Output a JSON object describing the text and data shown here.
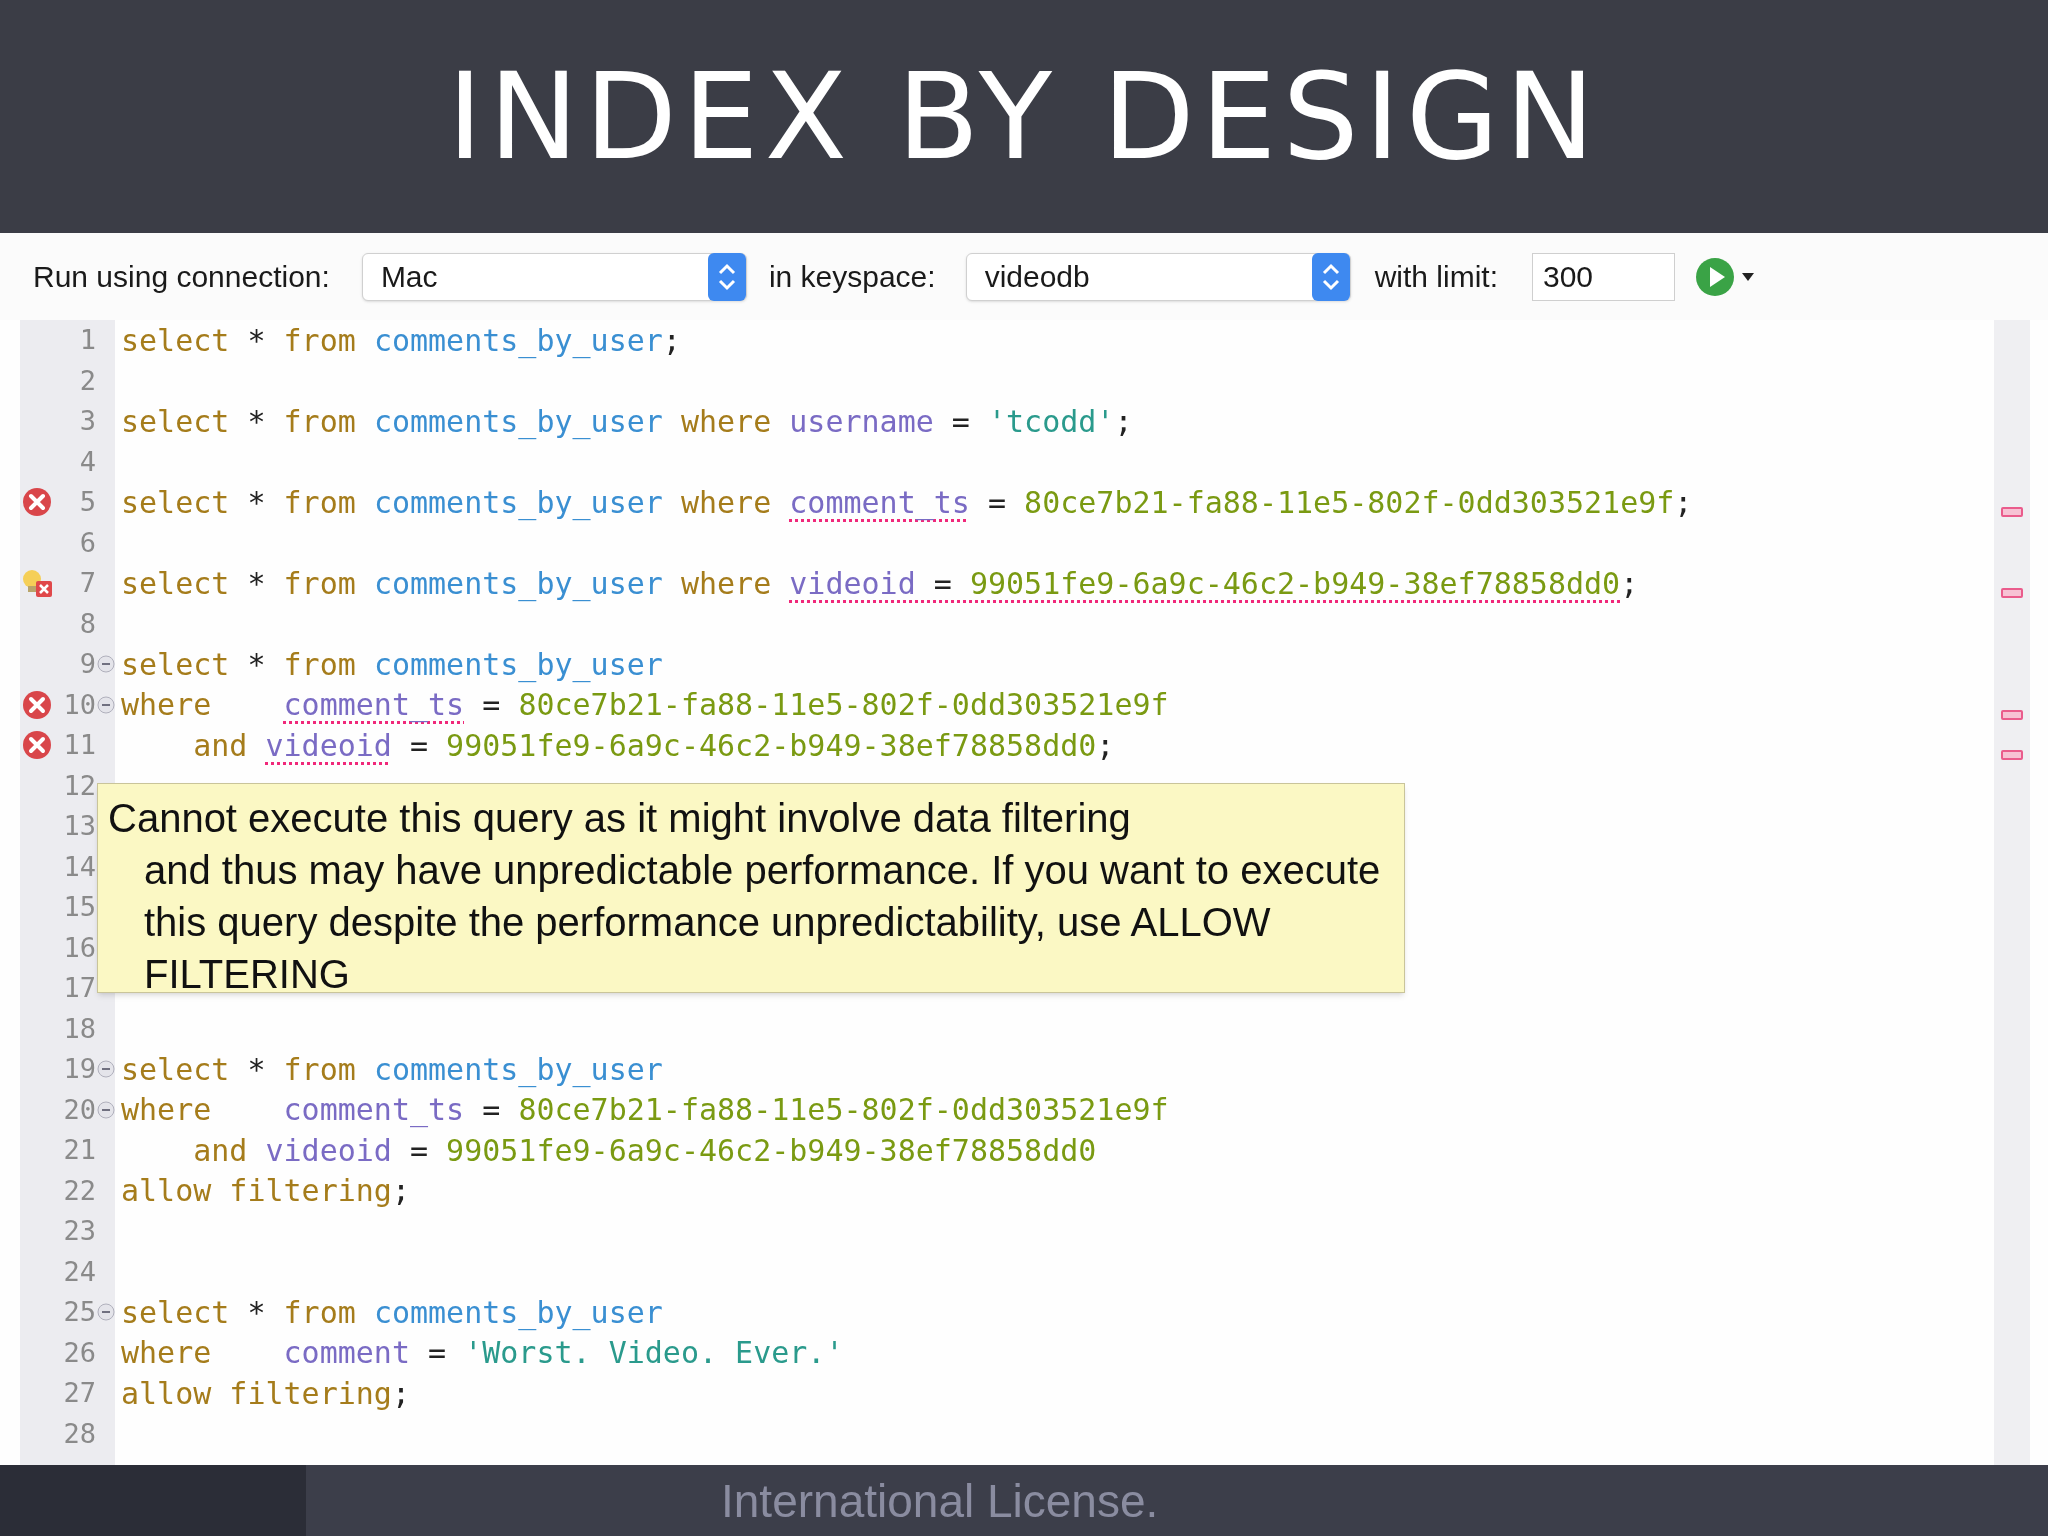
{
  "slide_title": "INDEX BY DESIGN",
  "toolbar": {
    "connection_label": "Run using connection:",
    "connection": "Mac",
    "keyspace_label": "in keyspace:",
    "keyspace": "videodb",
    "limit_label": "with limit:",
    "limit": "300"
  },
  "lines": [
    {
      "number": "1",
      "error": false,
      "warning": false,
      "tokens": [
        {
          "kind": "keyword",
          "text": "select"
        },
        {
          "kind": "plain",
          "text": "*"
        },
        {
          "kind": "keyword",
          "text": "from"
        },
        {
          "kind": "table",
          "text": "comments_by_user"
        },
        {
          "kind": "punct",
          "text": ";"
        }
      ]
    },
    {
      "number": "2",
      "error": false,
      "warning": false
    },
    {
      "number": "3",
      "error": false,
      "warning": false,
      "tokens": [
        {
          "kind": "keyword",
          "text": "select"
        },
        {
          "kind": "plain",
          "text": "*"
        },
        {
          "kind": "keyword",
          "text": "from"
        },
        {
          "kind": "table",
          "text": "comments_by_user"
        },
        {
          "kind": "keyword",
          "text": "where"
        },
        {
          "kind": "column",
          "text": "username"
        },
        {
          "kind": "plain",
          "text": "="
        },
        {
          "kind": "string",
          "text": "'tcodd'"
        },
        {
          "kind": "punct",
          "text": ";"
        }
      ]
    },
    {
      "number": "4",
      "error": false,
      "warning": false
    },
    {
      "number": "5",
      "error": true,
      "warning": false,
      "tokens": [
        {
          "kind": "keyword",
          "text": "select"
        },
        {
          "kind": "plain",
          "text": "*"
        },
        {
          "kind": "keyword",
          "text": "from"
        },
        {
          "kind": "table",
          "text": "comments_by_user"
        },
        {
          "kind": "keyword",
          "text": "where"
        },
        {
          "kind": "column",
          "text": "comment_ts",
          "squiggle": true
        },
        {
          "kind": "plain",
          "text": "="
        },
        {
          "kind": "uuid",
          "text": "80ce7b21-fa88-11e5-802f-0dd303521e9f"
        },
        {
          "kind": "punct",
          "text": ";"
        }
      ]
    },
    {
      "number": "6",
      "error": false,
      "warning": false
    },
    {
      "number": "7",
      "error": false,
      "warning": true,
      "tokens": [
        {
          "kind": "keyword",
          "text": "select"
        },
        {
          "kind": "plain",
          "text": "*"
        },
        {
          "kind": "keyword",
          "text": "from"
        },
        {
          "kind": "table",
          "text": "comments_by_user"
        },
        {
          "kind": "keyword",
          "text": "where"
        },
        {
          "kind": "column",
          "text": "videoid",
          "squiggle": true
        },
        {
          "kind": "plain",
          "text": "=",
          "squiggle": true
        },
        {
          "kind": "uuid",
          "text": "99051fe9-6a9c-46c2-b949-38ef78858dd0",
          "squiggle": true
        },
        {
          "kind": "punct",
          "text": ";"
        }
      ]
    },
    {
      "number": "8",
      "error": false,
      "warning": false
    },
    {
      "number": "9",
      "error": false,
      "warning": false,
      "fold": true,
      "tokens": [
        {
          "kind": "keyword",
          "text": "select"
        },
        {
          "kind": "plain",
          "text": "*"
        },
        {
          "kind": "keyword",
          "text": "from"
        },
        {
          "kind": "table",
          "text": "comments_by_user"
        }
      ]
    },
    {
      "number": "10",
      "error": true,
      "warning": false,
      "fold": true,
      "tokens": [
        {
          "kind": "keyword",
          "text": "where",
          "pad": true
        },
        {
          "kind": "column",
          "text": "comment_ts",
          "squiggle": true
        },
        {
          "kind": "plain",
          "text": "="
        },
        {
          "kind": "uuid",
          "text": "80ce7b21-fa88-11e5-802f-0dd303521e9f"
        }
      ]
    },
    {
      "number": "11",
      "error": true,
      "warning": false,
      "indent": true,
      "tokens": [
        {
          "kind": "keyword",
          "text": "and"
        },
        {
          "kind": "column",
          "text": "videoid",
          "squiggle": true
        },
        {
          "kind": "plain",
          "text": "="
        },
        {
          "kind": "uuid",
          "text": "99051fe9-6a9c-46c2-b949-38ef78858dd0"
        },
        {
          "kind": "punct",
          "text": ";"
        }
      ]
    },
    {
      "number": "12",
      "error": false,
      "warning": false
    },
    {
      "number": "13",
      "error": false,
      "warning": false
    },
    {
      "number": "14",
      "error": false,
      "warning": false
    },
    {
      "number": "15",
      "error": false,
      "warning": false
    },
    {
      "number": "16",
      "error": false,
      "warning": false
    },
    {
      "number": "17",
      "error": false,
      "warning": false
    },
    {
      "number": "18",
      "error": false,
      "warning": false
    },
    {
      "number": "19",
      "error": false,
      "warning": false,
      "fold": true,
      "tokens": [
        {
          "kind": "keyword",
          "text": "select"
        },
        {
          "kind": "plain",
          "text": "*"
        },
        {
          "kind": "keyword",
          "text": "from"
        },
        {
          "kind": "table",
          "text": "comments_by_user"
        }
      ]
    },
    {
      "number": "20",
      "error": false,
      "warning": false,
      "fold": true,
      "tokens": [
        {
          "kind": "keyword",
          "text": "where",
          "pad": true
        },
        {
          "kind": "column",
          "text": "comment_ts"
        },
        {
          "kind": "plain",
          "text": "="
        },
        {
          "kind": "uuid",
          "text": "80ce7b21-fa88-11e5-802f-0dd303521e9f"
        }
      ]
    },
    {
      "number": "21",
      "error": false,
      "warning": false,
      "indent": true,
      "tokens": [
        {
          "kind": "keyword",
          "text": "and"
        },
        {
          "kind": "column",
          "text": "videoid"
        },
        {
          "kind": "plain",
          "text": "="
        },
        {
          "kind": "uuid",
          "text": "99051fe9-6a9c-46c2-b949-38ef78858dd0"
        }
      ]
    },
    {
      "number": "22",
      "error": false,
      "warning": false,
      "tokens": [
        {
          "kind": "keyword",
          "text": "allow filtering"
        },
        {
          "kind": "punct",
          "text": ";"
        }
      ]
    },
    {
      "number": "23",
      "error": false,
      "warning": false
    },
    {
      "number": "24",
      "error": false,
      "warning": false
    },
    {
      "number": "25",
      "error": false,
      "warning": false,
      "fold": true,
      "tokens": [
        {
          "kind": "keyword",
          "text": "select"
        },
        {
          "kind": "plain",
          "text": "*"
        },
        {
          "kind": "keyword",
          "text": "from"
        },
        {
          "kind": "table",
          "text": "comments_by_user"
        }
      ]
    },
    {
      "number": "26",
      "error": false,
      "warning": false,
      "tokens": [
        {
          "kind": "keyword",
          "text": "where",
          "pad": true
        },
        {
          "kind": "column",
          "text": "comment"
        },
        {
          "kind": "plain",
          "text": "="
        },
        {
          "kind": "string",
          "text": "'Worst. Video. Ever.'"
        }
      ]
    },
    {
      "number": "27",
      "error": false,
      "warning": false,
      "tokens": [
        {
          "kind": "keyword",
          "text": "allow filtering"
        },
        {
          "kind": "punct",
          "text": ";"
        }
      ]
    },
    {
      "number": "28",
      "error": false,
      "warning": false
    }
  ],
  "tooltip": {
    "first_line": "Cannot execute this query as it might involve data filtering",
    "body": "and thus may have unpredictable performance. If you want to execute this query despite the performance unpredictability, use ALLOW FILTERING"
  },
  "footer": "International License."
}
